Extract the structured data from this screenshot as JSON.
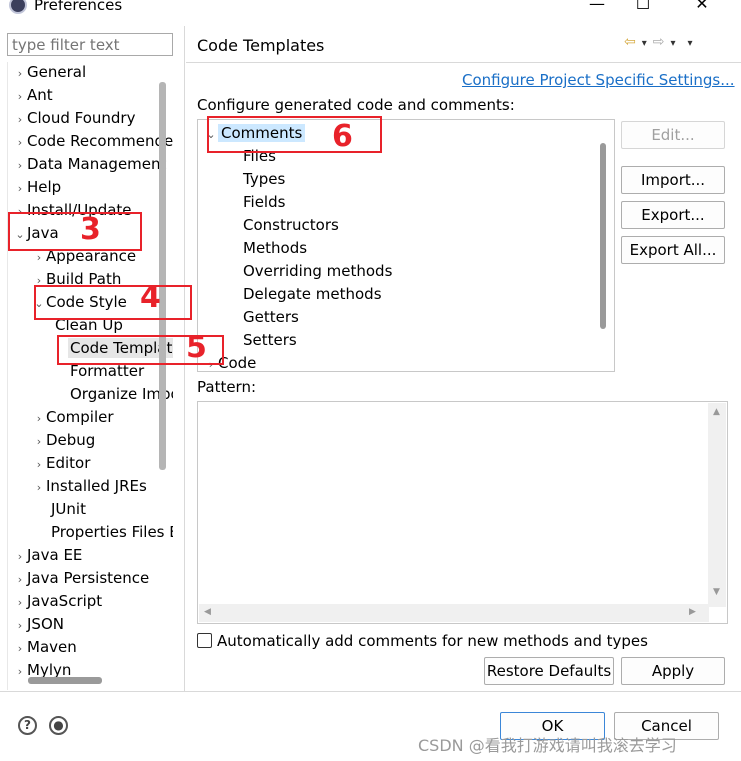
{
  "window": {
    "title": "Preferences",
    "minimize": "—",
    "maximize": "☐",
    "close": "✕"
  },
  "sidebar": {
    "filter_placeholder": "type filter text",
    "items": [
      {
        "label": "General",
        "chevron": "›"
      },
      {
        "label": "Ant",
        "chevron": "›"
      },
      {
        "label": "Cloud Foundry",
        "chevron": "›"
      },
      {
        "label": "Code Recommenders",
        "chevron": "›"
      },
      {
        "label": "Data Management",
        "chevron": "›"
      },
      {
        "label": "Help",
        "chevron": "›"
      },
      {
        "label": "Install/Update",
        "chevron": "›"
      },
      {
        "label": "Java",
        "chevron": "⌄"
      },
      {
        "label": "Appearance",
        "chevron": "›"
      },
      {
        "label": "Build Path",
        "chevron": "›"
      },
      {
        "label": "Code Style",
        "chevron": "⌄"
      },
      {
        "label": "Clean Up",
        "chevron": ""
      },
      {
        "label": "Code Templates",
        "chevron": ""
      },
      {
        "label": "Formatter",
        "chevron": ""
      },
      {
        "label": "Organize Imports",
        "chevron": ""
      },
      {
        "label": "Compiler",
        "chevron": "›"
      },
      {
        "label": "Debug",
        "chevron": "›"
      },
      {
        "label": "Editor",
        "chevron": "›"
      },
      {
        "label": "Installed JREs",
        "chevron": "›"
      },
      {
        "label": "JUnit",
        "chevron": ""
      },
      {
        "label": "Properties Files Editor",
        "chevron": ""
      },
      {
        "label": "Java EE",
        "chevron": "›"
      },
      {
        "label": "Java Persistence",
        "chevron": "›"
      },
      {
        "label": "JavaScript",
        "chevron": "›"
      },
      {
        "label": "JSON",
        "chevron": "›"
      },
      {
        "label": "Maven",
        "chevron": "›"
      },
      {
        "label": "Mylyn",
        "chevron": "›"
      }
    ]
  },
  "main": {
    "title": "Code Templates",
    "nav_back": "⇦",
    "nav_forward": "⇨",
    "nav_menu": "▾",
    "configure_link": "Configure Project Specific Settings...",
    "subheading": "Configure generated code and comments:",
    "templates": [
      {
        "label": "Comments",
        "chevron": "⌄"
      },
      {
        "label": "Files",
        "chevron": ""
      },
      {
        "label": "Types",
        "chevron": ""
      },
      {
        "label": "Fields",
        "chevron": ""
      },
      {
        "label": "Constructors",
        "chevron": ""
      },
      {
        "label": "Methods",
        "chevron": ""
      },
      {
        "label": "Overriding methods",
        "chevron": ""
      },
      {
        "label": "Delegate methods",
        "chevron": ""
      },
      {
        "label": "Getters",
        "chevron": ""
      },
      {
        "label": "Setters",
        "chevron": ""
      },
      {
        "label": "Code",
        "chevron": "›"
      }
    ],
    "buttons": {
      "edit": "Edit...",
      "import": "Import...",
      "export": "Export...",
      "export_all": "Export All..."
    },
    "pattern_label": "Pattern:",
    "checkbox_label": "Automatically add comments for new methods and types",
    "restore_defaults": "Restore Defaults",
    "apply": "Apply"
  },
  "footer": {
    "help_icon": "?",
    "ok": "OK",
    "cancel": "Cancel"
  },
  "annotations": [
    "3",
    "4",
    "5",
    "6"
  ],
  "watermark": "CSDN @看我打游戏请叫我滚去学习",
  "colors": {
    "annotation_red": "#e8222a",
    "link_blue": "#1a6fc7",
    "selection_blue": "#cce8ff"
  }
}
